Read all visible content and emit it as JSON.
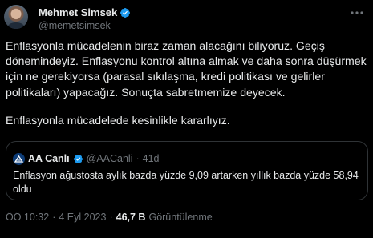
{
  "author": {
    "name": "Mehmet Simsek",
    "handle": "@memetsimsek"
  },
  "tweet": {
    "lines": [
      "Enflasyonla mücadelenin biraz zaman alacağını biliyoruz. Geçiş",
      "dönemindeyiz. Enflasyonu kontrol altına almak ve daha sonra düşürmek",
      "için ne gerekiyorsa (parasal sıkılaşma, kredi politikası ve gelirler",
      "politikaları) yapacağız. Sonuçta sabretmemize deyecek."
    ],
    "second_paragraph": "Enflasyonla mücadelede kesinlikle kararlıyız."
  },
  "quote": {
    "name": "AA Canlı",
    "handle": "@AACanli",
    "separator": "·",
    "time": "41d",
    "lines": [
      "Enflasyon ağustosta aylık bazda yüzde 9,09 artarken yıllık bazda yüzde 58,94",
      "oldu"
    ]
  },
  "meta": {
    "time": "ÖÖ 10:32",
    "separator": "·",
    "date": "4 Eyl 2023",
    "views_count": "46,7 B",
    "views_label": "Görüntülenme"
  },
  "colors": {
    "background": "#000000",
    "text": "#e7e9ea",
    "muted": "#71767b",
    "verified_blue": "#1d9bf0",
    "border": "#2f3336"
  },
  "icons": {
    "verified": "verified-badge-icon",
    "more": "more-options-icon",
    "aa_logo": "aa-logo-icon"
  }
}
